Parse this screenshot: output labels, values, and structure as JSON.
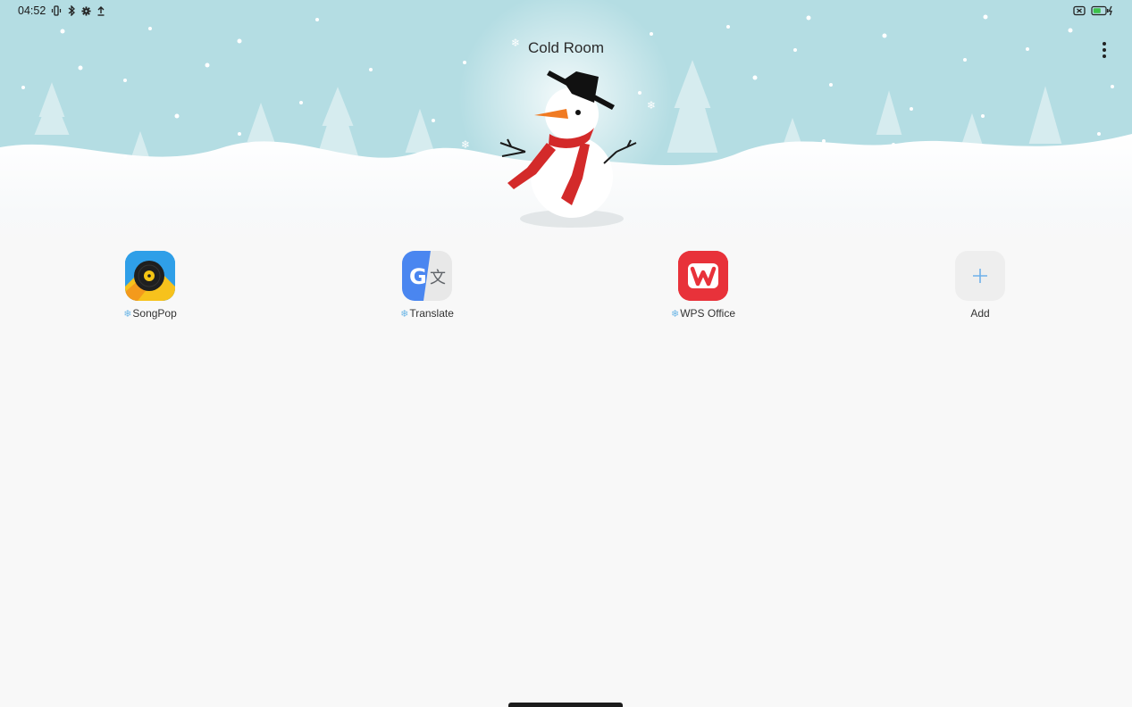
{
  "status_bar": {
    "time": "04:52"
  },
  "folder": {
    "title": "Cold Room"
  },
  "apps": [
    {
      "label": "SongPop",
      "snow_marker": true
    },
    {
      "label": "Translate",
      "snow_marker": true
    },
    {
      "label": "WPS Office",
      "snow_marker": true
    },
    {
      "label": "Add",
      "snow_marker": false
    }
  ],
  "icons": {
    "snow_marker": "snowflake-icon",
    "menu": "more-vertical-icon",
    "add": "plus-icon"
  },
  "colors": {
    "sky": "#b4dde3",
    "background": "#f8f8f8",
    "snowflake_marker": "#6fb7e6",
    "songpop_bg": "#2f9fe8",
    "wps_bg": "#e8323a",
    "translate_blue": "#4a86f0",
    "add_plus": "#6fb0ea"
  }
}
